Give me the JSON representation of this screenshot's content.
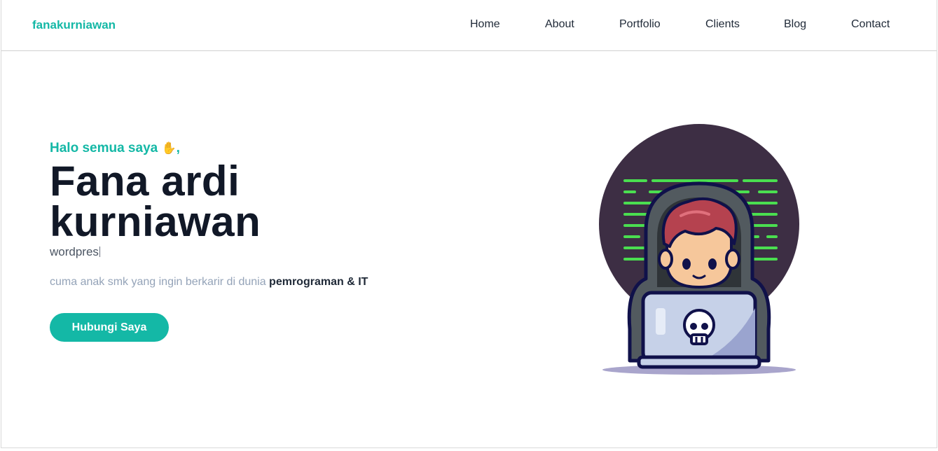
{
  "navbar": {
    "brand": "fanakurniawan",
    "links": [
      "Home",
      "About",
      "Portfolio",
      "Clients",
      "Blog",
      "Contact"
    ]
  },
  "hero": {
    "greeting": "Halo semua saya",
    "greeting_suffix": ",",
    "name_line1": "Fana ardi",
    "name_line2": "kurniawan",
    "typed_role": "wordpres",
    "tagline_prefix": "cuma anak smk yang ingin berkarir di dunia ",
    "tagline_bold": "pemrograman & IT",
    "cta_label": "Hubungi Saya"
  },
  "icons": {
    "greeting_emoji": "waving-hand-icon",
    "illustration": "hacker-with-laptop-illustration",
    "laptop_logo": "skull-icon"
  },
  "colors": {
    "accent": "#14b8a6",
    "heading": "#111827",
    "muted": "#94a3b8",
    "illustration_bg": "#3d2e44",
    "code_lines": "#4ade50"
  }
}
